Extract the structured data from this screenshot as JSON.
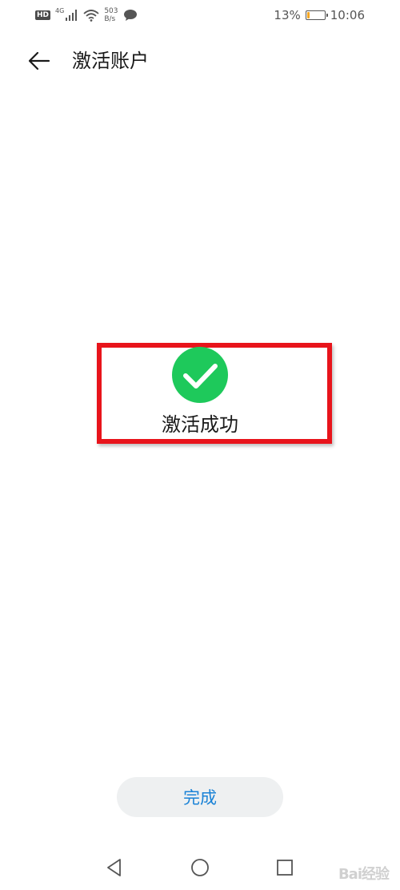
{
  "status_bar": {
    "hd_badge": "HD",
    "network_type": "4G",
    "speed_value": "503",
    "speed_unit": "B/s",
    "battery_percent": "13%",
    "battery_level": 0.13,
    "time": "10:06",
    "icons": [
      "hd-icon",
      "signal-icon",
      "wifi-icon",
      "message-icon",
      "battery-icon"
    ]
  },
  "header": {
    "title": "激活账户",
    "back_icon": "arrow-left-icon"
  },
  "main": {
    "status_icon": "checkmark-circle-icon",
    "status_text": "激活成功"
  },
  "actions": {
    "done_label": "完成"
  },
  "nav_bar": {
    "icons": [
      "back-triangle-icon",
      "home-circle-icon",
      "recents-square-icon"
    ]
  },
  "watermark": "Bai经验",
  "colors": {
    "success_green": "#1ec95b",
    "highlight_red": "#e8141b",
    "button_text_blue": "#1a82d6",
    "button_bg": "#eef0f1",
    "battery_orange": "#f5a623"
  }
}
